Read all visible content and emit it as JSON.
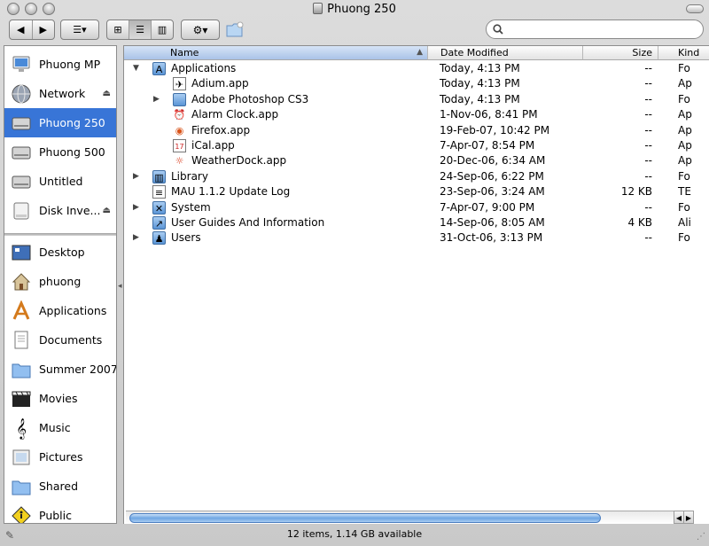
{
  "window": {
    "title": "Phuong 250"
  },
  "toolbar": {
    "back_label": "◀",
    "forward_label": "▶",
    "arrange_label": "☰▾",
    "view_icon": "⊞",
    "view_list": "☰",
    "view_column": "▥",
    "action_label": "⚙▾",
    "search_placeholder": ""
  },
  "sidebar": {
    "devices": [
      {
        "label": "Phuong MP",
        "icon": "computer-icon",
        "eject": ""
      },
      {
        "label": "Network",
        "icon": "network-globe-icon",
        "eject": "⏏"
      },
      {
        "label": "Phuong 250",
        "icon": "hard-drive-icon",
        "eject": "",
        "selected": true
      },
      {
        "label": "Phuong 500",
        "icon": "hard-drive-icon",
        "eject": ""
      },
      {
        "label": "Untitled",
        "icon": "hard-drive-icon",
        "eject": ""
      },
      {
        "label": "Disk Inve...",
        "icon": "disk-image-icon",
        "eject": "⏏"
      }
    ],
    "places": [
      {
        "label": "Desktop",
        "icon": "desktop-icon"
      },
      {
        "label": "phuong",
        "icon": "home-icon"
      },
      {
        "label": "Applications",
        "icon": "applications-icon"
      },
      {
        "label": "Documents",
        "icon": "documents-icon"
      },
      {
        "label": "Summer 2007",
        "icon": "folder-icon"
      },
      {
        "label": "Movies",
        "icon": "movies-icon"
      },
      {
        "label": "Music",
        "icon": "music-icon"
      },
      {
        "label": "Pictures",
        "icon": "pictures-icon"
      },
      {
        "label": "Shared",
        "icon": "folder-icon"
      },
      {
        "label": "Public",
        "icon": "public-icon"
      }
    ]
  },
  "columns": {
    "name": "Name",
    "date": "Date Modified",
    "size": "Size",
    "kind": "Kind",
    "sort_arrow": "▲"
  },
  "rows": [
    {
      "disc": "▼",
      "indent": 0,
      "icon": "applications-folder-icon",
      "name": "Applications",
      "date": "Today, 4:13 PM",
      "size": "--",
      "kind": "Fo"
    },
    {
      "disc": "",
      "indent": 1,
      "icon": "adium-icon",
      "name": "Adium.app",
      "date": "Today, 4:13 PM",
      "size": "--",
      "kind": "Ap"
    },
    {
      "disc": "▶",
      "indent": 1,
      "icon": "folder-icon",
      "name": "Adobe Photoshop CS3",
      "date": "Today, 4:13 PM",
      "size": "--",
      "kind": "Fo"
    },
    {
      "disc": "",
      "indent": 1,
      "icon": "alarm-clock-icon",
      "name": "Alarm Clock.app",
      "date": "1-Nov-06, 8:41 PM",
      "size": "--",
      "kind": "Ap"
    },
    {
      "disc": "",
      "indent": 1,
      "icon": "firefox-icon",
      "name": "Firefox.app",
      "date": "19-Feb-07, 10:42 PM",
      "size": "--",
      "kind": "Ap"
    },
    {
      "disc": "",
      "indent": 1,
      "icon": "ical-icon",
      "name": "iCal.app",
      "date": "7-Apr-07, 8:54 PM",
      "size": "--",
      "kind": "Ap"
    },
    {
      "disc": "",
      "indent": 1,
      "icon": "weatherdock-icon",
      "name": "WeatherDock.app",
      "date": "20-Dec-06, 6:34 AM",
      "size": "--",
      "kind": "Ap"
    },
    {
      "disc": "▶",
      "indent": 0,
      "icon": "library-folder-icon",
      "name": "Library",
      "date": "24-Sep-06, 6:22 PM",
      "size": "--",
      "kind": "Fo"
    },
    {
      "disc": "",
      "indent": 0,
      "icon": "text-document-icon",
      "name": "MAU 1.1.2 Update Log",
      "date": "23-Sep-06, 3:24 AM",
      "size": "12 KB",
      "kind": "TE"
    },
    {
      "disc": "▶",
      "indent": 0,
      "icon": "system-folder-icon",
      "name": "System",
      "date": "7-Apr-07, 9:00 PM",
      "size": "--",
      "kind": "Fo"
    },
    {
      "disc": "",
      "indent": 0,
      "icon": "alias-folder-icon",
      "name": "User Guides And Information",
      "date": "14-Sep-06, 8:05 AM",
      "size": "4 KB",
      "kind": "Ali"
    },
    {
      "disc": "▶",
      "indent": 0,
      "icon": "users-folder-icon",
      "name": "Users",
      "date": "31-Oct-06, 3:13 PM",
      "size": "--",
      "kind": "Fo"
    }
  ],
  "scroll": {
    "left_arrow": "◀",
    "right_arrow": "▶"
  },
  "status": {
    "text": "12 items, 1.14 GB available"
  },
  "colors": {
    "selection": "#3875d7",
    "scroll_thumb": "#6fa6e3"
  }
}
